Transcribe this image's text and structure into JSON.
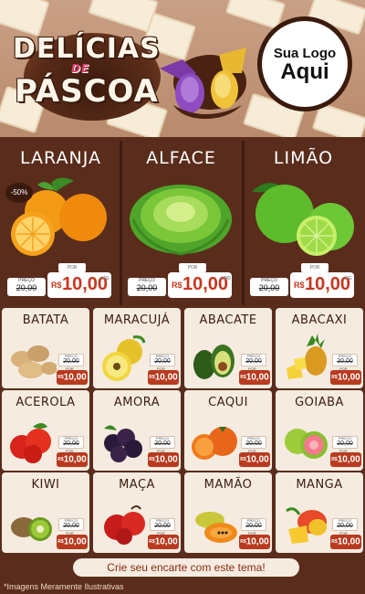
{
  "header": {
    "title_line1": "DELÍCIAS",
    "title_line2": "DE",
    "title_line3": "PÁSCOA",
    "logo_line1": "Sua Logo",
    "logo_line2": "Aqui"
  },
  "featured": [
    {
      "name": "LARANJA",
      "discount": "-50%",
      "prev_label": "PREÇO",
      "prev_price": "20,00",
      "por_label": "POR",
      "currency": "R$",
      "price": "10,00",
      "unit": "KG"
    },
    {
      "name": "ALFACE",
      "prev_label": "PREÇO",
      "prev_price": "20,00",
      "por_label": "POR",
      "currency": "R$",
      "price": "10,00",
      "unit": "UND"
    },
    {
      "name": "LIMÃO",
      "prev_label": "PREÇO",
      "prev_price": "20,00",
      "por_label": "POR",
      "currency": "R$",
      "price": "10,00",
      "unit": "KG"
    }
  ],
  "products": [
    {
      "name": "BATATA",
      "prev": "20,00",
      "price": "10,00"
    },
    {
      "name": "MARACUJÁ",
      "prev": "20,00",
      "price": "10,00"
    },
    {
      "name": "ABACATE",
      "prev": "20,00",
      "price": "10,00"
    },
    {
      "name": "ABACAXI",
      "prev": "20,00",
      "price": "10,00"
    },
    {
      "name": "ACEROLA",
      "prev": "20,00",
      "price": "10,00"
    },
    {
      "name": "AMORA",
      "prev": "20,00",
      "price": "10,00"
    },
    {
      "name": "CAQUI",
      "prev": "20,00",
      "price": "10,00"
    },
    {
      "name": "GOIABA",
      "prev": "20,00",
      "price": "10,00"
    },
    {
      "name": "KIWI",
      "prev": "20,00",
      "price": "10,00"
    },
    {
      "name": "MAÇA",
      "prev": "20,00",
      "price": "10,00"
    },
    {
      "name": "MAMÃO",
      "prev": "20,00",
      "price": "10,00"
    },
    {
      "name": "MANGA",
      "prev": "20,00",
      "price": "10,00"
    }
  ],
  "mini_labels": {
    "prev_label": "PREÇO",
    "por_label": "POR",
    "currency": "R$"
  },
  "footer": {
    "banner": "Crie seu encarte com este tema!",
    "disclaimer": "*Imagens Meramente Ilustrativas"
  },
  "colors": {
    "background": "#5a2c1c",
    "card": "#f5ebe0",
    "price_red": "#b83a1f",
    "header": "#c9a085"
  }
}
